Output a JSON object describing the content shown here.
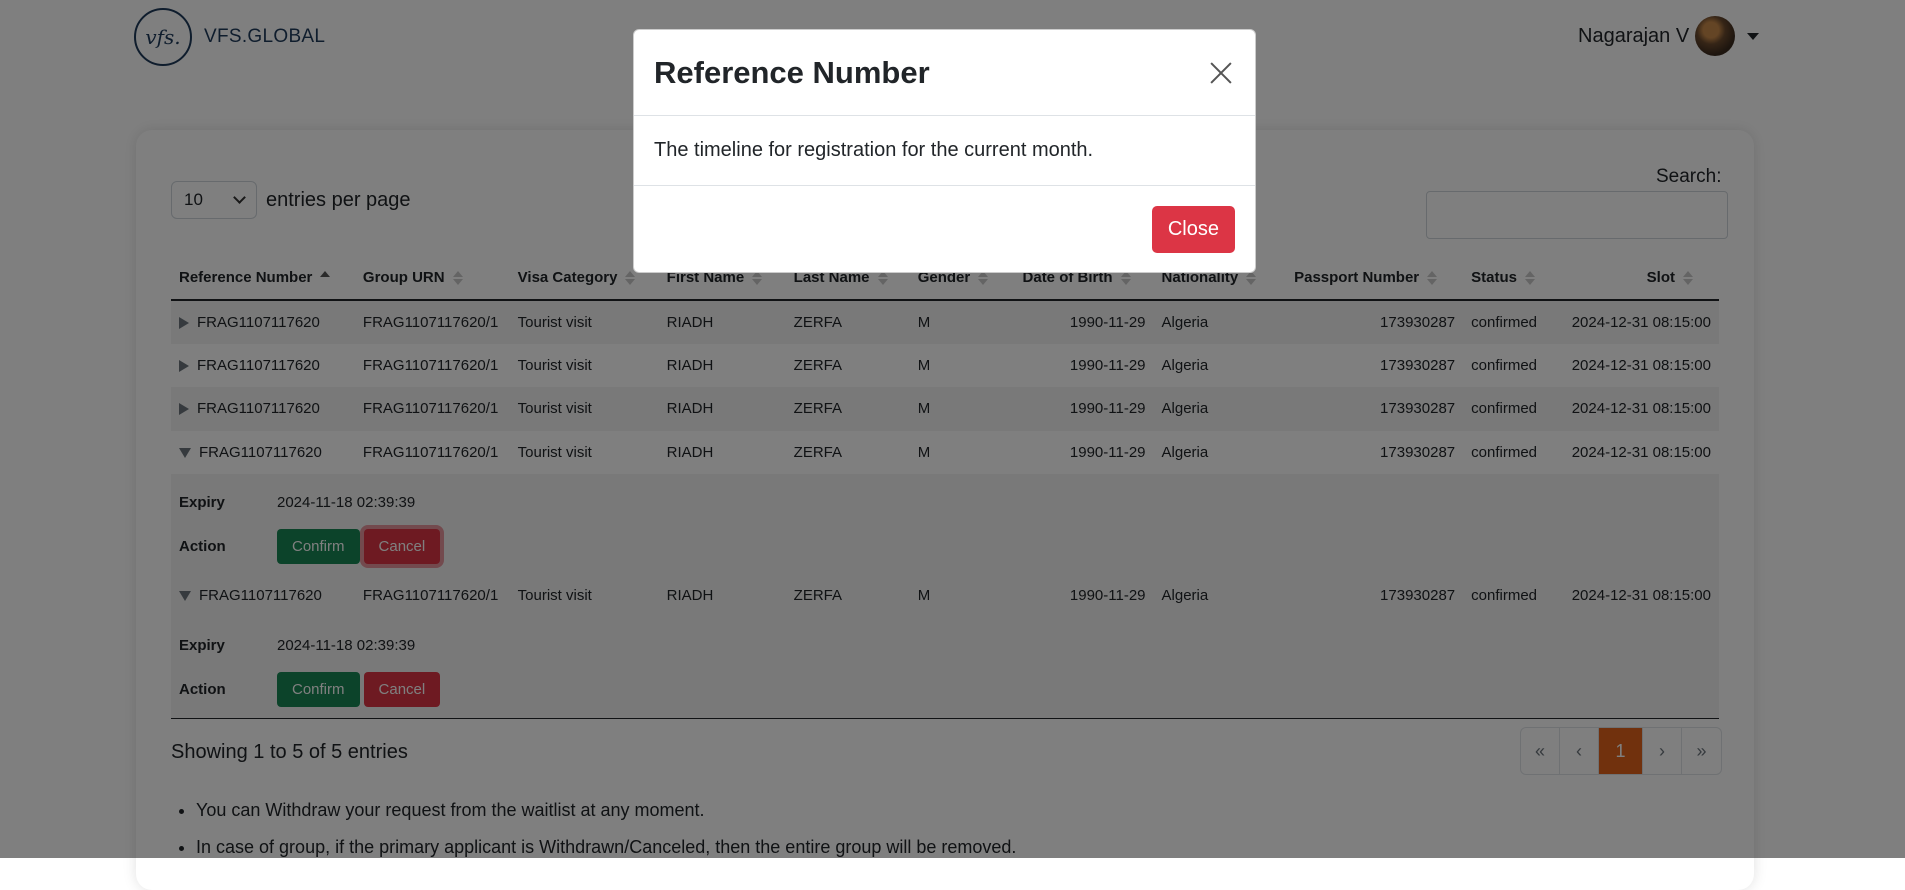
{
  "header": {
    "logo_mark": "vfs.",
    "brand_name": "VFS.GLOBAL",
    "user_name": "Nagarajan V"
  },
  "table_controls": {
    "entries_value": "10",
    "entries_label": "entries per page",
    "search_label": "Search:",
    "search_value": ""
  },
  "table": {
    "columns": [
      "Reference Number",
      "Group URN",
      "Visa Category",
      "First Name",
      "Last Name",
      "Gender",
      "Date of Birth",
      "Nationality",
      "Passport Number",
      "Status",
      "Slot"
    ],
    "rows": [
      {
        "ref": "FRAG1107117620",
        "urn": "FRAG1107117620/1",
        "visa": "Tourist visit",
        "first": "RIADH",
        "last": "ZERFA",
        "gender": "M",
        "dob": "1990-11-29",
        "nationality": "Algeria",
        "passport": "173930287",
        "status": "confirmed",
        "slot": "2024-12-31 08:15:00"
      },
      {
        "ref": "FRAG1107117620",
        "urn": "FRAG1107117620/1",
        "visa": "Tourist visit",
        "first": "RIADH",
        "last": "ZERFA",
        "gender": "M",
        "dob": "1990-11-29",
        "nationality": "Algeria",
        "passport": "173930287",
        "status": "confirmed",
        "slot": "2024-12-31 08:15:00"
      },
      {
        "ref": "FRAG1107117620",
        "urn": "FRAG1107117620/1",
        "visa": "Tourist visit",
        "first": "RIADH",
        "last": "ZERFA",
        "gender": "M",
        "dob": "1990-11-29",
        "nationality": "Algeria",
        "passport": "173930287",
        "status": "confirmed",
        "slot": "2024-12-31 08:15:00"
      },
      {
        "ref": "FRAG1107117620",
        "urn": "FRAG1107117620/1",
        "visa": "Tourist visit",
        "first": "RIADH",
        "last": "ZERFA",
        "gender": "M",
        "dob": "1990-11-29",
        "nationality": "Algeria",
        "passport": "173930287",
        "status": "confirmed",
        "slot": "2024-12-31 08:15:00"
      },
      {
        "ref": "FRAG1107117620",
        "urn": "FRAG1107117620/1",
        "visa": "Tourist visit",
        "first": "RIADH",
        "last": "ZERFA",
        "gender": "M",
        "dob": "1990-11-29",
        "nationality": "Algeria",
        "passport": "173930287",
        "status": "confirmed",
        "slot": "2024-12-31 08:15:00"
      }
    ],
    "child": {
      "expiry_label": "Expiry",
      "expiry_value": "2024-11-18 02:39:39",
      "action_label": "Action",
      "confirm_label": "Confirm",
      "cancel_label": "Cancel"
    }
  },
  "footer": {
    "info": "Showing 1 to 5 of 5 entries",
    "pagination": [
      "«",
      "‹",
      "1",
      "›",
      "»"
    ],
    "notes": [
      "You can Withdraw your request from the waitlist at any moment.",
      "In case of group, if the primary applicant is Withdrawn/Canceled, then the entire group will be removed."
    ]
  },
  "modal": {
    "title": "Reference Number",
    "body": "The timeline for registration for the current month.",
    "close_label": "Close"
  },
  "colors": {
    "brand": "#1f3a5b",
    "confirm": "#198754",
    "cancel": "#dc3545",
    "page_active": "#e2621b"
  }
}
